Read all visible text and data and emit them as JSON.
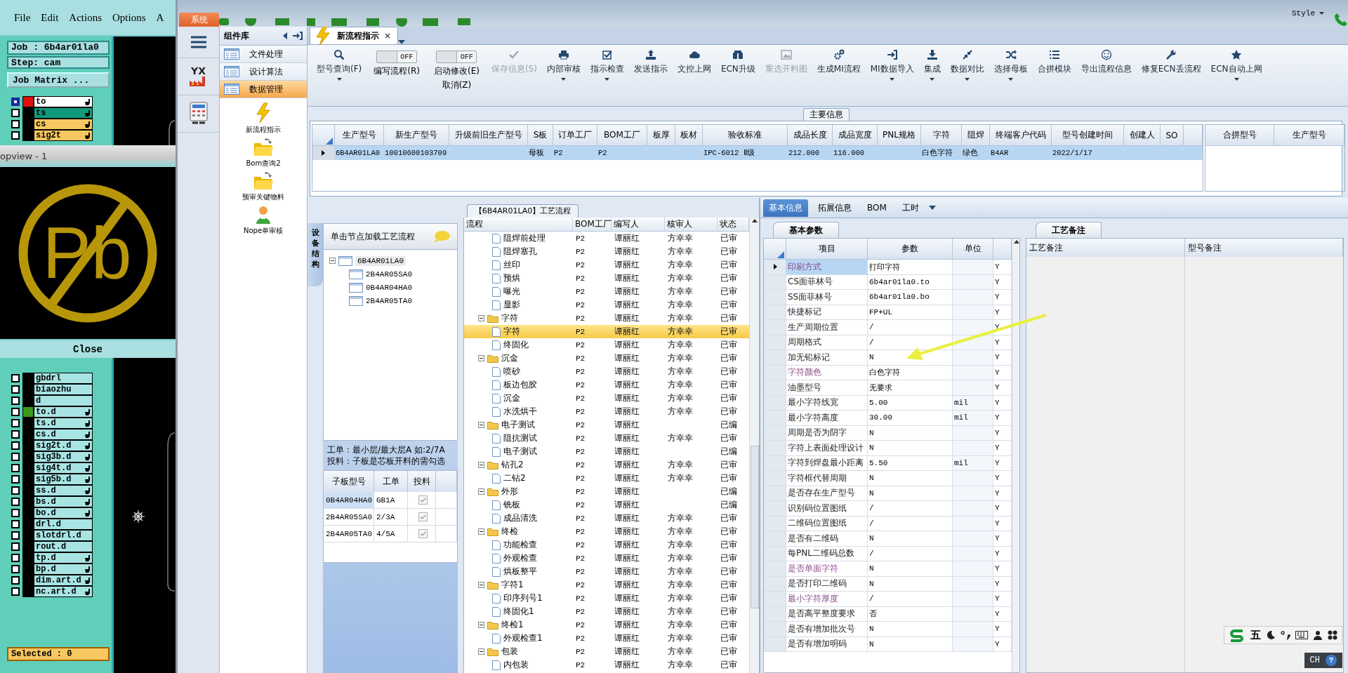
{
  "genesis": {
    "menu": [
      "File",
      "Edit",
      "Actions",
      "Options",
      "A"
    ],
    "job": "Job : 6b4ar01la0",
    "step": "Step: cam",
    "matrix_button": "Job Matrix ...",
    "layers_top": [
      {
        "name": "to",
        "color": "#ffffff",
        "checked": true,
        "affected": true,
        "swatch": {
          "color": "#e01010"
        }
      },
      {
        "name": "ts",
        "color": "#109a7c",
        "checked": false,
        "affected": true
      },
      {
        "name": "cs",
        "color": "#f8c860",
        "checked": false,
        "affected": true
      },
      {
        "name": "sig2t",
        "color": "#f8c860",
        "checked": false,
        "affected": true
      }
    ],
    "popup": {
      "title": "opview - 1",
      "symbol": "Pb",
      "close": "Close"
    },
    "layers_bottom": [
      {
        "name": "gbdrl",
        "color": "#a8e4e4",
        "checked": false,
        "affected": false
      },
      {
        "name": "biaozhu",
        "color": "#a8e4e4",
        "checked": false,
        "affected": false
      },
      {
        "name": "d",
        "color": "#a8e4e4",
        "checked": false,
        "affected": false
      },
      {
        "name": "to.d",
        "color": "#a8e4e4",
        "checked": false,
        "affected": true,
        "swatch": {
          "color": "#3c9a1a"
        }
      },
      {
        "name": "ts.d",
        "color": "#a8e4e4",
        "checked": false,
        "affected": true
      },
      {
        "name": "cs.d",
        "color": "#a8e4e4",
        "checked": false,
        "affected": true
      },
      {
        "name": "sig2t.d",
        "color": "#a8e4e4",
        "checked": false,
        "affected": true
      },
      {
        "name": "sig3b.d",
        "color": "#a8e4e4",
        "checked": false,
        "affected": true
      },
      {
        "name": "sig4t.d",
        "color": "#a8e4e4",
        "checked": false,
        "affected": true
      },
      {
        "name": "sig5b.d",
        "color": "#a8e4e4",
        "checked": false,
        "affected": true
      },
      {
        "name": "ss.d",
        "color": "#a8e4e4",
        "checked": false,
        "affected": true
      },
      {
        "name": "bs.d",
        "color": "#a8e4e4",
        "checked": false,
        "affected": true
      },
      {
        "name": "bo.d",
        "color": "#a8e4e4",
        "checked": false,
        "affected": true
      },
      {
        "name": "drl.d",
        "color": "#a8e4e4",
        "checked": false,
        "affected": false
      },
      {
        "name": "slotdrl.d",
        "color": "#a8e4e4",
        "checked": false,
        "affected": false
      },
      {
        "name": "rout.d",
        "color": "#a8e4e4",
        "checked": false,
        "affected": false
      },
      {
        "name": "tp.d",
        "color": "#a8e4e4",
        "checked": false,
        "affected": true
      },
      {
        "name": "bp.d",
        "color": "#a8e4e4",
        "checked": false,
        "affected": true
      },
      {
        "name": "dim.art.d",
        "color": "#a8e4e4",
        "checked": false,
        "affected": true
      },
      {
        "name": "nc.art.d",
        "color": "#a8e4e4",
        "checked": false,
        "affected": true
      }
    ],
    "selected_count": "Selected : 0"
  },
  "app": {
    "system_tab": "系统",
    "style_menu": "Style",
    "logo_text": "YX",
    "components": {
      "title": "组件库",
      "categories": [
        {
          "label": "文件处理",
          "selected": false
        },
        {
          "label": "设计算法",
          "selected": false
        },
        {
          "label": "数据管理",
          "selected": true
        }
      ],
      "tools": [
        {
          "kind": "lightning",
          "label": "新流程指示"
        },
        {
          "kind": "folder",
          "label": "Bom查询2"
        },
        {
          "kind": "folder",
          "label": "预审关键物料"
        },
        {
          "kind": "person",
          "label": "Nope单审核"
        }
      ]
    },
    "doc_tabs": [
      {
        "label": "新流程指示",
        "selected": true
      }
    ],
    "ribbon": [
      {
        "kind": "button",
        "label": "型号查询(F)",
        "dropdown": true,
        "disabled": false
      },
      {
        "kind": "toggle",
        "label": "编写流程(R)",
        "state_label": "OFF",
        "on": false
      },
      {
        "kind": "toggle",
        "label": "启动修改(E)",
        "sub_label": "取消(Z)",
        "state_label": "OFF",
        "on": false
      },
      {
        "kind": "button",
        "label": "保存信息(S)",
        "dropdown": false,
        "disabled": true
      },
      {
        "kind": "button",
        "label": "内部审核",
        "dropdown": true,
        "disabled": false
      },
      {
        "kind": "button",
        "label": "指示检查",
        "dropdown": true,
        "disabled": false
      },
      {
        "kind": "button",
        "label": "发送指示",
        "dropdown": false,
        "disabled": false
      },
      {
        "kind": "button",
        "label": "文控上网",
        "dropdown": false,
        "disabled": false
      },
      {
        "kind": "button",
        "label": "ECN升级",
        "dropdown": false,
        "disabled": false
      },
      {
        "kind": "button",
        "label": "重选开料图",
        "dropdown": false,
        "disabled": true
      },
      {
        "kind": "button",
        "label": "生成MI流程",
        "dropdown": false,
        "disabled": false
      },
      {
        "kind": "button",
        "label": "MI数据导入",
        "dropdown": true,
        "disabled": false
      },
      {
        "kind": "button",
        "label": "集成",
        "dropdown": true,
        "disabled": false
      },
      {
        "kind": "button",
        "label": "数据对比",
        "dropdown": true,
        "disabled": false
      },
      {
        "kind": "button",
        "label": "选择母板",
        "dropdown": true,
        "disabled": false
      },
      {
        "kind": "button",
        "label": "合拼模块",
        "dropdown": false,
        "disabled": false
      },
      {
        "kind": "button",
        "label": "导出流程信息",
        "dropdown": false,
        "disabled": false
      },
      {
        "kind": "button",
        "label": "修复ECN丢流程",
        "dropdown": false,
        "disabled": false
      },
      {
        "kind": "button",
        "label": "ECN自动上网",
        "dropdown": true,
        "disabled": false
      }
    ],
    "main_info": {
      "title": "主要信息",
      "columns": [
        "生产型号",
        "新生产型号",
        "升级前旧生产型号",
        "S板",
        "订单工厂",
        "BOM工厂",
        "板厚",
        "板材",
        "验收标准",
        "成品长度",
        "成品宽度",
        "PNL规格",
        "字符",
        "阻焊",
        "终端客户代码",
        "型号创建时间",
        "创建人",
        "SO"
      ],
      "rows": [
        {
          "selected": true,
          "cells": [
            "6B4AR01LA0",
            "10010600103709",
            null,
            "母板",
            "P2",
            "P2",
            null,
            null,
            "IPC-6012 Ⅱ级",
            "212.000",
            "116.000",
            null,
            "白色字符",
            "绿色",
            "B4AR",
            "2022/1/17",
            null,
            null
          ]
        }
      ],
      "merge_columns": [
        "合拼型号",
        "生产型号"
      ]
    }
  },
  "flow": {
    "title": "【6B4AR01LA0】工艺流程",
    "side_tab": "设备结构",
    "tree_hint": "单击节点加载工艺流程",
    "tree": [
      {
        "label": "6B4AR01LA0",
        "expanded": true,
        "children": [
          {
            "label": "2B4AR05SA0"
          },
          {
            "label": "0B4AR04HA0"
          },
          {
            "label": "2B4AR05TA0"
          }
        ]
      }
    ],
    "notes": [
      "工单：最小层/最大层A 如:2/7A",
      "投料：子板是芯板开料的需勾选"
    ],
    "sub_columns": [
      "子板型号",
      "工单",
      "投料"
    ],
    "sub_rows": [
      {
        "cells": [
          "0B4AR04HA0",
          "GB1A"
        ],
        "checked": true,
        "selected": true
      },
      {
        "cells": [
          "2B4AR05SA0",
          "2/3A"
        ],
        "checked": true,
        "selected": false
      },
      {
        "cells": [
          "2B4AR05TA0",
          "4/5A"
        ],
        "checked": true,
        "selected": false
      }
    ],
    "columns": [
      "流程",
      "BOM工厂",
      "编写人",
      "核审人",
      "状态"
    ],
    "continued_steps": [
      {
        "label": "阻焊前处理",
        "bom_factory": "P2",
        "writer": "谭丽红",
        "reviewer": "方幸幸",
        "status": "已审",
        "selected": false
      },
      {
        "label": "阻焊塞孔",
        "bom_factory": "P2",
        "writer": "谭丽红",
        "reviewer": "方幸幸",
        "status": "已审",
        "selected": false
      },
      {
        "label": "丝印",
        "bom_factory": "P2",
        "writer": "谭丽红",
        "reviewer": "方幸幸",
        "status": "已审",
        "selected": false
      },
      {
        "label": "预烘",
        "bom_factory": "P2",
        "writer": "谭丽红",
        "reviewer": "方幸幸",
        "status": "已审",
        "selected": false
      },
      {
        "label": "曝光",
        "bom_factory": "P2",
        "writer": "谭丽红",
        "reviewer": "方幸幸",
        "status": "已审",
        "selected": false
      },
      {
        "label": "显影",
        "bom_factory": "P2",
        "writer": "谭丽红",
        "reviewer": "方幸幸",
        "status": "已审",
        "selected": false
      }
    ],
    "groups": [
      {
        "label": "字符",
        "bom_factory": "P2",
        "writer": "谭丽红",
        "reviewer": "方幸幸",
        "status": "已审",
        "selected": false,
        "expanded": true,
        "children": [
          {
            "label": "字符",
            "bom_factory": "P2",
            "writer": "谭丽红",
            "reviewer": "方幸幸",
            "status": "已审",
            "selected": true
          },
          {
            "label": "终固化",
            "bom_factory": "P2",
            "writer": "谭丽红",
            "reviewer": "方幸幸",
            "status": "已审",
            "selected": false
          }
        ]
      },
      {
        "label": "沉金",
        "bom_factory": "P2",
        "writer": "谭丽红",
        "reviewer": "方幸幸",
        "status": "已审",
        "selected": false,
        "expanded": true,
        "children": [
          {
            "label": "喷砂",
            "bom_factory": "P2",
            "writer": "谭丽红",
            "reviewer": "方幸幸",
            "status": "已审",
            "selected": false
          },
          {
            "label": "板边包胶",
            "bom_factory": "P2",
            "writer": "谭丽红",
            "reviewer": "方幸幸",
            "status": "已审",
            "selected": false
          },
          {
            "label": "沉金",
            "bom_factory": "P2",
            "writer": "谭丽红",
            "reviewer": "方幸幸",
            "status": "已审",
            "selected": false
          },
          {
            "label": "水洗烘干",
            "bom_factory": "P2",
            "writer": "谭丽红",
            "reviewer": "方幸幸",
            "status": "已审",
            "selected": false
          }
        ]
      },
      {
        "label": "电子测试",
        "bom_factory": "P2",
        "writer": "谭丽红",
        "status": "已编",
        "selected": false,
        "expanded": true,
        "children": [
          {
            "label": "阻抗测试",
            "bom_factory": "P2",
            "writer": "谭丽红",
            "reviewer": "方幸幸",
            "status": "已审",
            "selected": false
          },
          {
            "label": "电子测试",
            "bom_factory": "P2",
            "writer": "谭丽红",
            "status": "已编",
            "selected": false
          }
        ]
      },
      {
        "label": "钻孔2",
        "bom_factory": "P2",
        "writer": "谭丽红",
        "reviewer": "方幸幸",
        "status": "已审",
        "selected": false,
        "expanded": true,
        "children": [
          {
            "label": "二钻2",
            "bom_factory": "P2",
            "writer": "谭丽红",
            "reviewer": "方幸幸",
            "status": "已审",
            "selected": false
          }
        ]
      },
      {
        "label": "外形",
        "bom_factory": "P2",
        "writer": "谭丽红",
        "status": "已编",
        "selected": false,
        "expanded": true,
        "children": [
          {
            "label": "铣板",
            "bom_factory": "P2",
            "writer": "谭丽红",
            "status": "已编",
            "selected": false
          },
          {
            "label": "成品清洗",
            "bom_factory": "P2",
            "writer": "谭丽红",
            "reviewer": "方幸幸",
            "status": "已审",
            "selected": false
          }
        ]
      },
      {
        "label": "终检",
        "bom_factory": "P2",
        "writer": "谭丽红",
        "reviewer": "方幸幸",
        "status": "已审",
        "selected": false,
        "expanded": true,
        "children": [
          {
            "label": "功能检查",
            "bom_factory": "P2",
            "writer": "谭丽红",
            "reviewer": "方幸幸",
            "status": "已审",
            "selected": false
          },
          {
            "label": "外观检查",
            "bom_factory": "P2",
            "writer": "谭丽红",
            "reviewer": "方幸幸",
            "status": "已审",
            "selected": false
          },
          {
            "label": "烘板整平",
            "bom_factory": "P2",
            "writer": "谭丽红",
            "reviewer": "方幸幸",
            "status": "已审",
            "selected": false
          }
        ]
      },
      {
        "label": "字符1",
        "bom_factory": "P2",
        "writer": "谭丽红",
        "reviewer": "方幸幸",
        "status": "已审",
        "selected": false,
        "expanded": true,
        "children": [
          {
            "label": "印序列号1",
            "bom_factory": "P2",
            "writer": "谭丽红",
            "reviewer": "方幸幸",
            "status": "已审",
            "selected": false
          },
          {
            "label": "终固化1",
            "bom_factory": "P2",
            "writer": "谭丽红",
            "reviewer": "方幸幸",
            "status": "已审",
            "selected": false
          }
        ]
      },
      {
        "label": "终检1",
        "bom_factory": "P2",
        "writer": "谭丽红",
        "reviewer": "方幸幸",
        "status": "已审",
        "selected": false,
        "expanded": true,
        "children": [
          {
            "label": "外观检查1",
            "bom_factory": "P2",
            "writer": "谭丽红",
            "reviewer": "方幸幸",
            "status": "已审",
            "selected": false
          }
        ]
      },
      {
        "label": "包装",
        "bom_factory": "P2",
        "writer": "谭丽红",
        "reviewer": "方幸幸",
        "status": "已审",
        "selected": false,
        "expanded": true,
        "children": [
          {
            "label": "内包装",
            "bom_factory": "P2",
            "writer": "谭丽红",
            "reviewer": "方幸幸",
            "status": "已审",
            "selected": false
          }
        ]
      }
    ]
  },
  "params": {
    "tabs": [
      {
        "label": "基本信息",
        "selected": true
      },
      {
        "label": "拓展信息",
        "selected": false
      },
      {
        "label": "BOM",
        "selected": false
      },
      {
        "label": "工时",
        "selected": false
      }
    ],
    "subtab": "基本参数",
    "columns": [
      "项目",
      "参数",
      "单位"
    ],
    "rows": [
      {
        "item": "印刷方式",
        "value": "打印字符",
        "column_4": "Y",
        "highlighted": true,
        "selected": true
      },
      {
        "item": "CS面菲林号",
        "value": "6b4ar01la0.to",
        "column_4": "Y",
        "highlighted": false,
        "selected": false
      },
      {
        "item": "SS面菲林号",
        "value": "6b4ar01la0.bo",
        "column_4": "Y",
        "highlighted": false,
        "selected": false
      },
      {
        "item": "快捷标记",
        "value": "FP+UL",
        "column_4": "Y",
        "highlighted": false,
        "selected": false
      },
      {
        "item": "生产周期位置",
        "value": "/",
        "column_4": "Y",
        "highlighted": false,
        "selected": false
      },
      {
        "item": "周期格式",
        "value": "/",
        "column_4": "Y",
        "highlighted": false,
        "selected": false
      },
      {
        "item": "加无铅标记",
        "value": "N",
        "column_4": "Y",
        "highlighted": false,
        "selected": false
      },
      {
        "item": "字符颜色",
        "value": "白色字符",
        "column_4": "Y",
        "highlighted": true,
        "selected": false
      },
      {
        "item": "油墨型号",
        "value": "无要求",
        "column_4": "Y",
        "highlighted": false,
        "selected": false
      },
      {
        "item": "最小字符线宽",
        "value": "5.00",
        "unit": "mil",
        "column_4": "Y",
        "highlighted": false,
        "selected": false
      },
      {
        "item": "最小字符高度",
        "value": "30.00",
        "unit": "mil",
        "column_4": "Y",
        "highlighted": false,
        "selected": false
      },
      {
        "item": "周期是否为阴字",
        "value": "N",
        "column_4": "Y",
        "highlighted": false,
        "selected": false
      },
      {
        "item": "字符上表面处理设计",
        "value": "N",
        "column_4": "Y",
        "highlighted": false,
        "selected": false
      },
      {
        "item": "字符到焊盘最小距离",
        "value": "5.50",
        "unit": "mil",
        "column_4": "Y",
        "highlighted": false,
        "selected": false
      },
      {
        "item": "字符框代替周期",
        "value": "N",
        "column_4": "Y",
        "highlighted": false,
        "selected": false
      },
      {
        "item": "是否存在生产型号",
        "value": "N",
        "column_4": "Y",
        "highlighted": false,
        "selected": false
      },
      {
        "item": "识别码位置图纸",
        "value": "/",
        "column_4": "Y",
        "highlighted": false,
        "selected": false
      },
      {
        "item": "二维码位置图纸",
        "value": "/",
        "column_4": "Y",
        "highlighted": false,
        "selected": false
      },
      {
        "item": "是否有二维码",
        "value": "N",
        "column_4": "Y",
        "highlighted": false,
        "selected": false
      },
      {
        "item": "每PNL二维码总数",
        "value": "/",
        "column_4": "Y",
        "highlighted": false,
        "selected": false
      },
      {
        "item": "是否单面字符",
        "value": "N",
        "column_4": "Y",
        "highlighted": true,
        "selected": false
      },
      {
        "item": "是否打印二维码",
        "value": "N",
        "column_4": "Y",
        "highlighted": false,
        "selected": false
      },
      {
        "item": "最小字符厚度",
        "value": "/",
        "column_4": "Y",
        "highlighted": true,
        "selected": false
      },
      {
        "item": "是否高平整度要求",
        "value": "否",
        "column_4": "Y",
        "highlighted": false,
        "selected": false
      },
      {
        "item": "是否有增加批次号",
        "value": "N",
        "column_4": "Y",
        "highlighted": false,
        "selected": false
      },
      {
        "item": "是否有增加明码",
        "value": "N",
        "column_4": "Y",
        "highlighted": false,
        "selected": false
      }
    ]
  },
  "remarks": {
    "tab": "工艺备注",
    "columns": [
      "工艺备注",
      "型号备注"
    ]
  },
  "ime": {
    "input_mode": "五",
    "language": "CH",
    "help": "?"
  }
}
